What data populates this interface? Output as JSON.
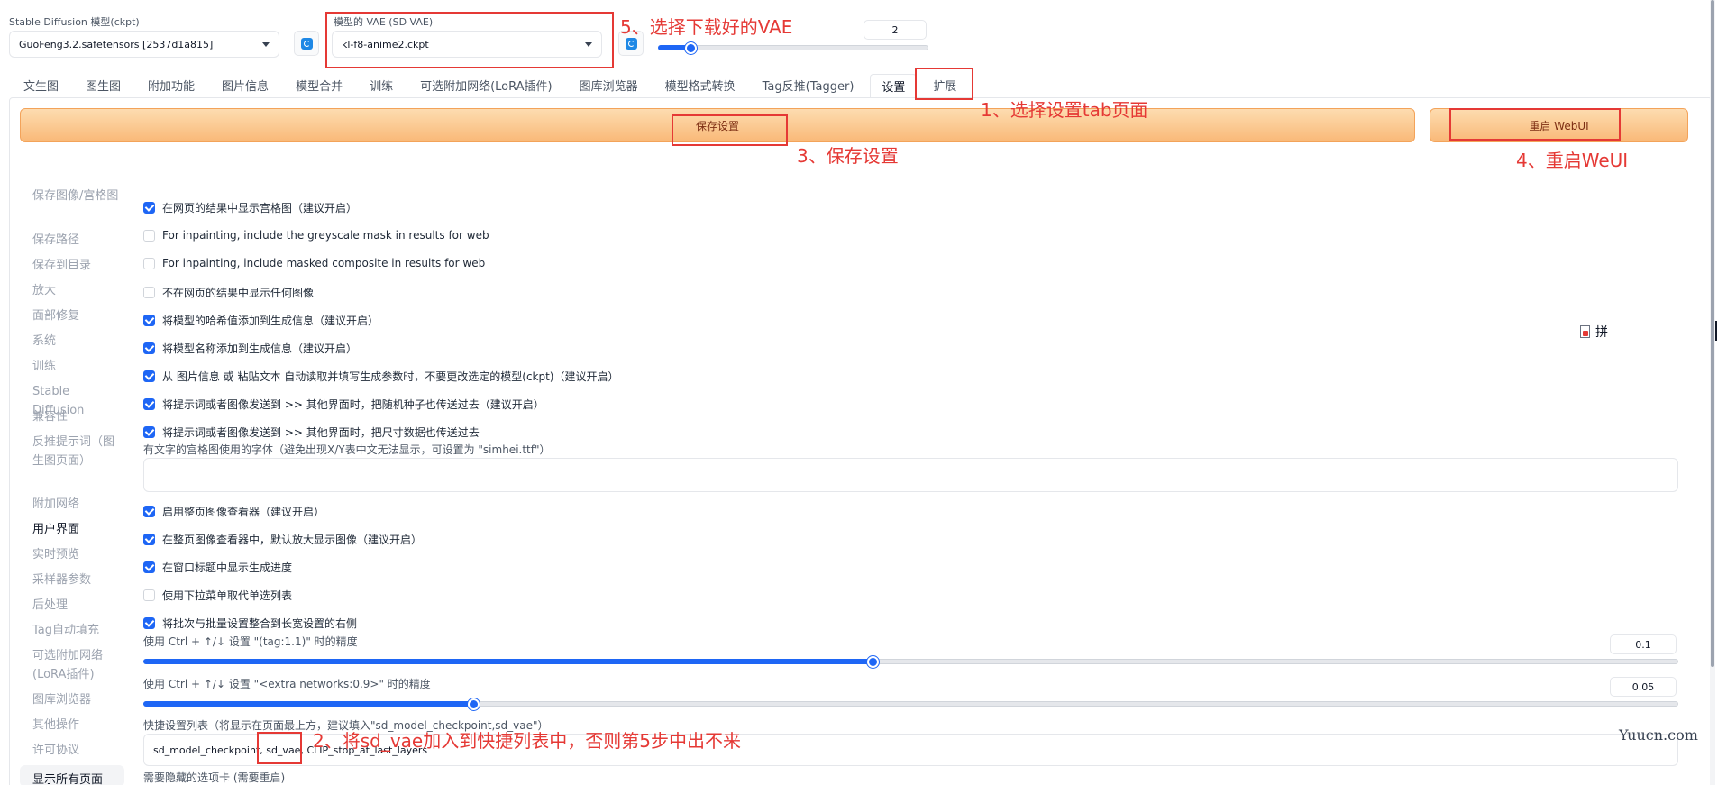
{
  "top": {
    "ckpt_label": "Stable Diffusion 模型(ckpt)",
    "ckpt_value": "GuoFeng3.2.safetensors [2537d1a815]",
    "vae_label": "模型的 VAE (SD VAE)",
    "vae_value": "kl-f8-anime2.ckpt",
    "clip_value": "2",
    "clip_slider_fraction": 0.12
  },
  "tabs": [
    "文生图",
    "图生图",
    "附加功能",
    "图片信息",
    "模型合并",
    "训练",
    "可选附加网络(LoRA插件)",
    "图库浏览器",
    "模型格式转换",
    "Tag反推(Tagger)",
    "设置",
    "扩展"
  ],
  "active_tab": "设置",
  "buttons": {
    "save": "保存设置",
    "restart": "重启 WebUI"
  },
  "sidebar": {
    "items": [
      "保存图像/宫格图",
      "保存路径",
      "保存到目录",
      "放大",
      "面部修复",
      "系统",
      "训练",
      "Stable Diffusion",
      "兼容性",
      "反推提示词（图生图页面）",
      "附加网络",
      "用户界面",
      "实时预览",
      "采样器参数",
      "后处理",
      "Tag自动填充",
      "可选附加网络(LoRA插件)",
      "图库浏览器",
      "其他操作",
      "许可协议"
    ],
    "active": "用户界面",
    "show_all": "显示所有页面"
  },
  "settings": {
    "checkboxes": [
      {
        "label": "在网页的结果中显示宫格图（建议开启）",
        "checked": true
      },
      {
        "label": "For inpainting, include the greyscale mask in results for web",
        "checked": false
      },
      {
        "label": "For inpainting, include masked composite in results for web",
        "checked": false
      },
      {
        "label": "不在网页的结果中显示任何图像",
        "checked": false
      },
      {
        "label": "将模型的哈希值添加到生成信息（建议开启）",
        "checked": true
      },
      {
        "label": "将模型名称添加到生成信息（建议开启）",
        "checked": true
      },
      {
        "label": "从 图片信息 或 粘贴文本 自动读取并填写生成参数时，不要更改选定的模型(ckpt)（建议开启）",
        "checked": true
      },
      {
        "label": "将提示词或者图像发送到 >> 其他界面时，把随机种子也传送过去（建议开启）",
        "checked": true
      },
      {
        "label": "将提示词或者图像发送到 >> 其他界面时，把尺寸数据也传送过去",
        "checked": true
      }
    ],
    "font_label": "有文字的宫格图使用的字体（避免出现X/Y表中文无法显示，可设置为 \"simhei.ttf\"）",
    "font_value": "",
    "checkboxes2": [
      {
        "label": "启用整页图像查看器（建议开启）",
        "checked": true
      },
      {
        "label": "在整页图像查看器中，默认放大显示图像（建议开启）",
        "checked": true
      },
      {
        "label": "在窗口标题中显示生成进度",
        "checked": true
      },
      {
        "label": "使用下拉菜单取代单选列表",
        "checked": false
      },
      {
        "label": "将批次与批量设置整合到长宽设置的右侧",
        "checked": true
      }
    ],
    "precision1_label": "使用 Ctrl + ↑/↓ 设置 \"(tag:1.1)\" 时的精度",
    "precision1_value": "0.1",
    "precision1_fraction": 0.475,
    "precision2_label": "使用 Ctrl + ↑/↓ 设置 \"<extra networks:0.9>\" 时的精度",
    "precision2_value": "0.05",
    "precision2_fraction": 0.215,
    "quick_label": "快捷设置列表（将显示在页面最上方，建议填入\"sd_model_checkpoint,sd_vae\"）",
    "quick_value": "sd_model_checkpoint, sd_vae, CLIP_stop_at_last_layers",
    "hidden_tabs_label": "需要隐藏的选项卡 (需要重启)"
  },
  "annotations": {
    "a1": "1、选择设置tab页面",
    "a2": "2、将sd_vae加入到快捷列表中，否则第5步中出不来",
    "a3": "3、保存设置",
    "a4": "4、重启WeUI",
    "a5": "5、选择下载好的VAE"
  },
  "ime": {
    "pin": "拼"
  },
  "watermark": "Yuucn.com",
  "colors": {
    "accent": "#1e66f5",
    "annotation": "#e53935",
    "button_orange": "#f9b978"
  }
}
